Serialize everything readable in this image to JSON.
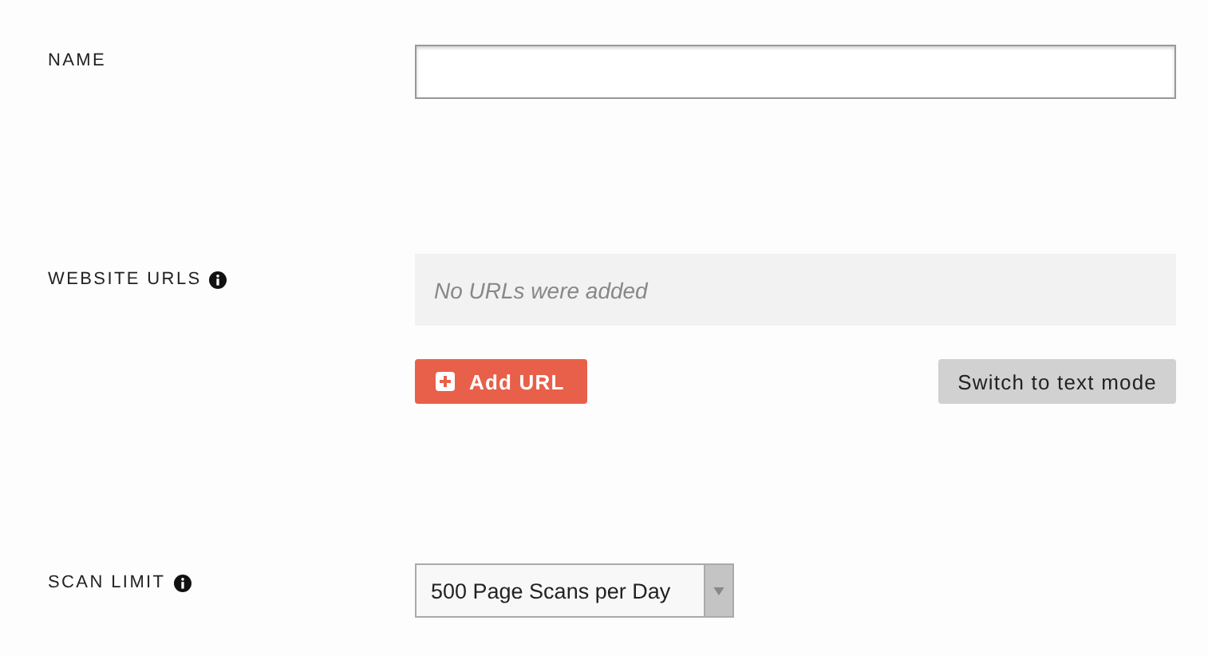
{
  "name": {
    "label": "NAME"
  },
  "website_urls": {
    "label": "WEBSITE URLS",
    "info": true,
    "empty_message": "No URLs were added",
    "add_button": "Add URL",
    "switch_button": "Switch to text mode"
  },
  "scan_limit": {
    "label": "SCAN LIMIT",
    "info": true,
    "value": "500 Page Scans per Day"
  }
}
